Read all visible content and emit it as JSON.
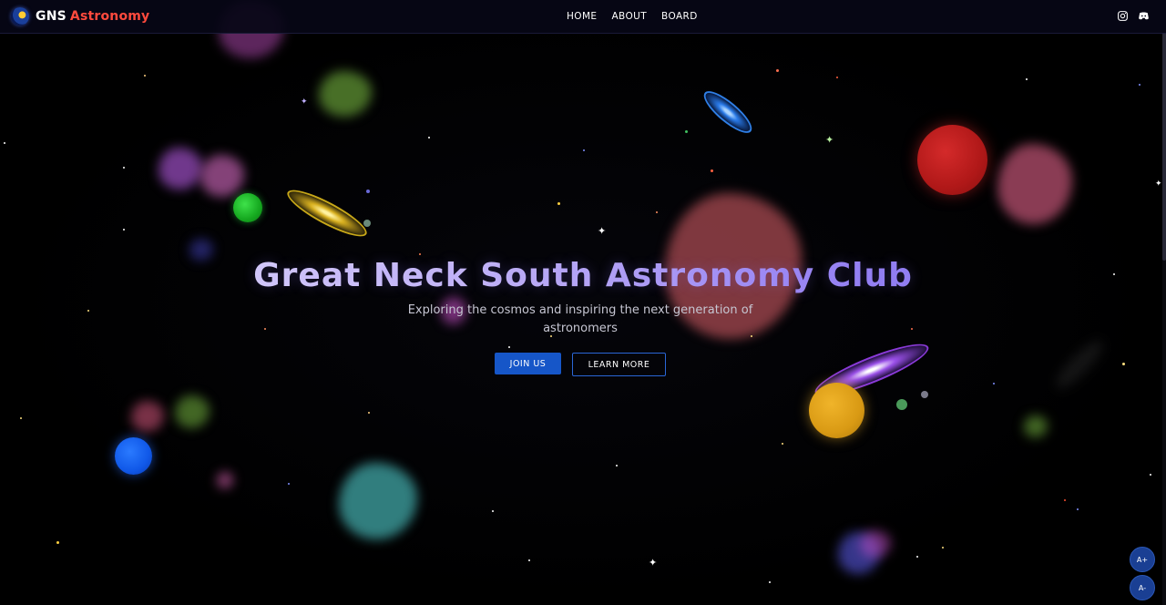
{
  "nav": {
    "logo_gns": "GNS",
    "logo_astronomy": "Astronomy",
    "links": [
      "HOME",
      "ABOUT",
      "BOARD"
    ],
    "social_icons": [
      "instagram-icon",
      "discord-icon"
    ]
  },
  "hero": {
    "title": "Great Neck South Astronomy Club",
    "subtitle": "Exploring the cosmos and inspiring the next generation of astronomers",
    "join_label": "JOIN US",
    "learn_label": "LEARN MORE"
  },
  "font_controls": {
    "increase": "A+",
    "decrease": "A-"
  },
  "colors": {
    "background": "#000000",
    "nav_bg": "#060616",
    "logo_accent": "#ff4a3d",
    "title_gradient_start": "#ece8ff",
    "title_gradient_end": "#7d6cf0",
    "button_primary": "#1656c8",
    "button_outline": "#2a66d6"
  }
}
